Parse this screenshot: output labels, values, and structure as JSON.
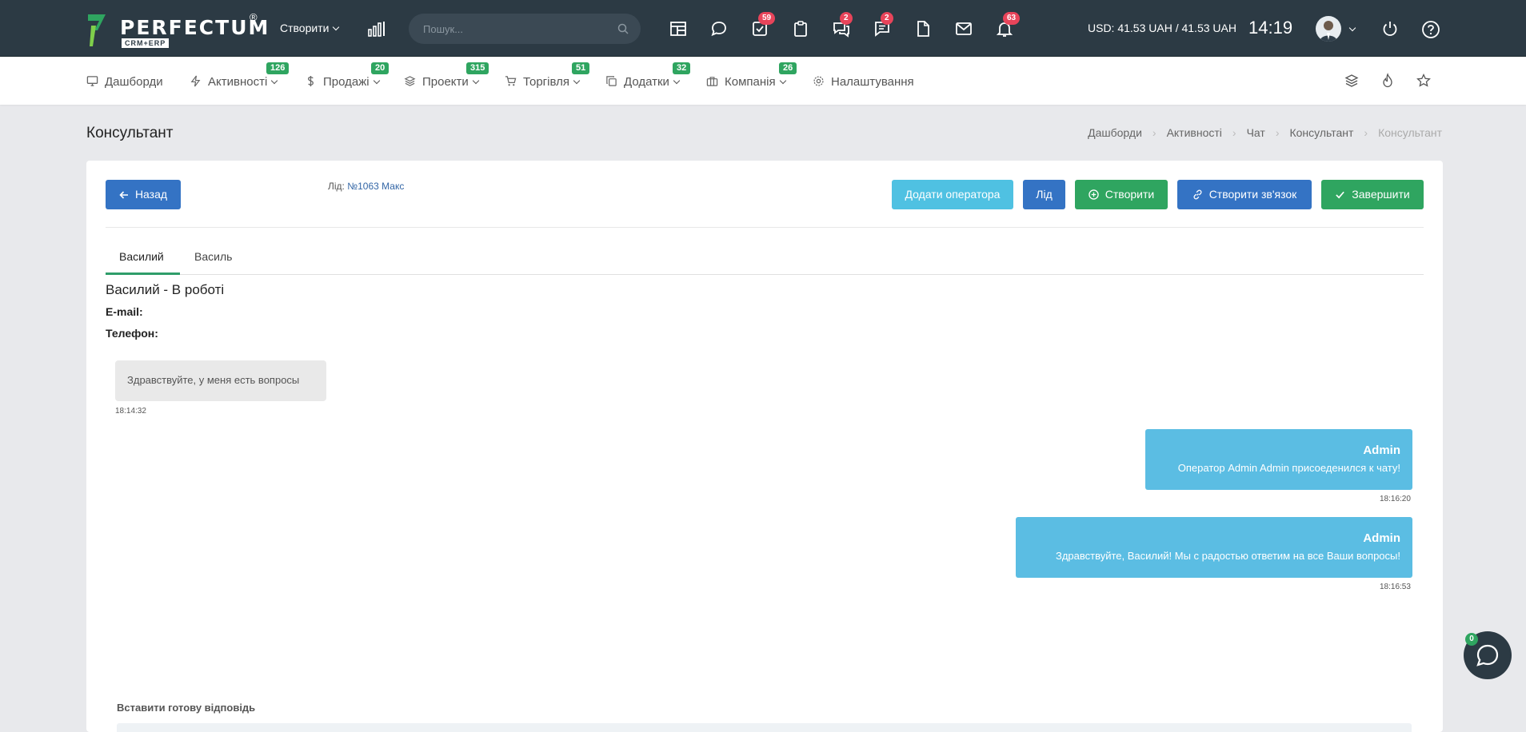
{
  "app": {
    "logo_text": "PERFECTUM",
    "logo_sub": "CRM+ERP",
    "logo_reg": "®",
    "brand_color": "#2c3a44",
    "accent_green": "#2fa560"
  },
  "topbar": {
    "create_label": "Створити",
    "search_placeholder": "Пошук...",
    "icons": [
      {
        "name": "layout-icon",
        "badge": ""
      },
      {
        "name": "chat-icon",
        "badge": ""
      },
      {
        "name": "task-check-icon",
        "badge": "59"
      },
      {
        "name": "clipboard-icon",
        "badge": ""
      },
      {
        "name": "comments-icon",
        "badge": "2"
      },
      {
        "name": "message-lines-icon",
        "badge": "2"
      },
      {
        "name": "document-icon",
        "badge": ""
      },
      {
        "name": "mail-icon",
        "badge": ""
      },
      {
        "name": "bell-icon",
        "badge": "63"
      }
    ],
    "currency": "USD: 41.53 UAH / 41.53 UAH",
    "clock": "14:19"
  },
  "nav": {
    "items": [
      {
        "label": "Дашборди",
        "badge": ""
      },
      {
        "label": "Активності",
        "badge": "126"
      },
      {
        "label": "Продажі",
        "badge": "20"
      },
      {
        "label": "Проекти",
        "badge": "315"
      },
      {
        "label": "Торгівля",
        "badge": "51"
      },
      {
        "label": "Додатки",
        "badge": "32"
      },
      {
        "label": "Компанія",
        "badge": "26"
      },
      {
        "label": "Налаштування",
        "badge": ""
      }
    ]
  },
  "page": {
    "title": "Консультант",
    "breadcrumbs": [
      "Дашборди",
      "Активності",
      "Чат",
      "Консультант",
      "Консультант"
    ]
  },
  "toolbar": {
    "back_label": "Назад",
    "lead_prefix": "Лід:",
    "lead_link": "№1063 Макс",
    "add_operator_label": "Додати оператора",
    "lead_label": "Лід",
    "create_label": "Створити",
    "link_label": "Створити зв'язок",
    "finish_label": "Завершити"
  },
  "tabs": [
    "Василий",
    "Василь"
  ],
  "client": {
    "header": "Василий - В роботі",
    "email_label": "E-mail:",
    "phone_label": "Телефон:"
  },
  "messages": [
    {
      "side": "in",
      "author": "",
      "text": "Здравствуйте, у меня есть вопросы",
      "time": "18:14:32"
    },
    {
      "side": "out",
      "author": "Admin",
      "text": "Оператор Admin Admin присоеденился к чату!",
      "time": "18:16:20"
    },
    {
      "side": "out",
      "author": "Admin",
      "text": "Здравствуйте, Василий! Мы с радостью ответим на все Ваши вопросы!",
      "time": "18:16:53"
    }
  ],
  "quick_reply": {
    "label": "Вставити готову відповідь"
  },
  "chat_widget": {
    "badge": "0"
  }
}
